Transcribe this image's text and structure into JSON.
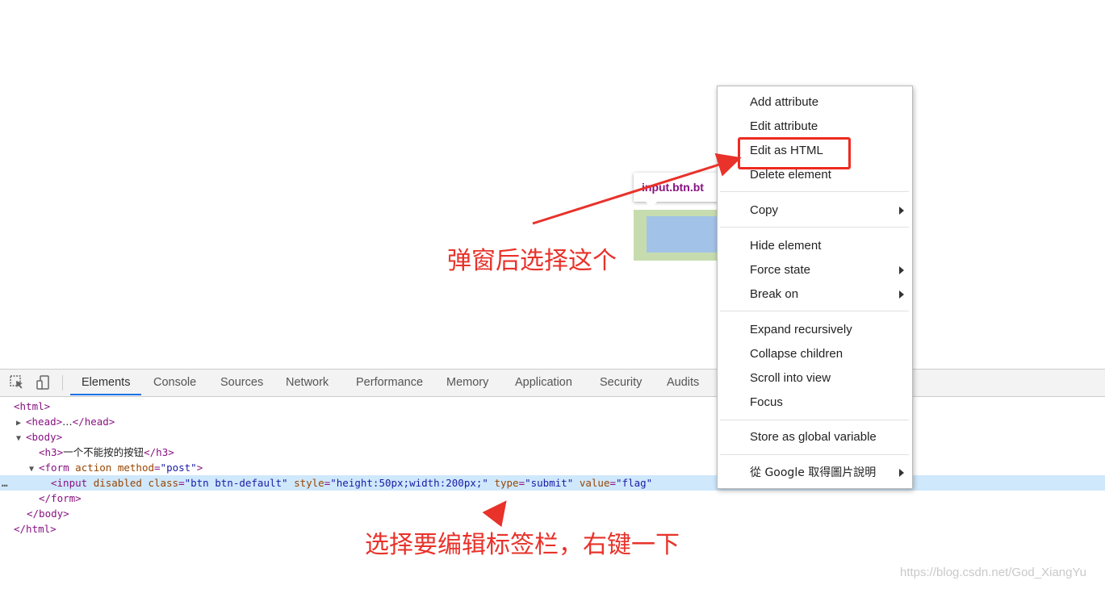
{
  "page": {
    "tooltip_label": "input.btn.bt"
  },
  "annotations": {
    "top": "弹窗后选择这个",
    "bottom": "选择要编辑标签栏，右键一下"
  },
  "devtools": {
    "tabs": [
      "Elements",
      "Console",
      "Sources",
      "Network",
      "Performance",
      "Memory",
      "Application",
      "Security",
      "Audits"
    ],
    "active_tab": "Elements",
    "dom": {
      "l1": "<html>",
      "l2_open": "<head>",
      "l2_ellipsis": "…",
      "l2_close": "</head>",
      "l3": "<body>",
      "l4_open": "<h3>",
      "l4_text": "一个不能按的按钮",
      "l4_close": "</h3>",
      "l5_tag": "<form",
      "l5_attr1": "action",
      "l5_attr2": "method",
      "l5_eq": "=",
      "l5_val2": "\"post\"",
      "l5_end": ">",
      "l6_tag": "<input",
      "l6_a1": "disabled",
      "l6_a2": "class",
      "l6_v2": "\"btn btn-default\"",
      "l6_a3": "style",
      "l6_v3": "\"height:50px;width:200px;\"",
      "l6_a4": "type",
      "l6_v4": "\"submit\"",
      "l6_a5": "value",
      "l6_v5": "\"flag\"",
      "eq": "=",
      "l7": "</form>",
      "l8": "</body>",
      "l9": "</html>",
      "dots": "…"
    }
  },
  "context_menu": {
    "items": [
      "Add attribute",
      "Edit attribute",
      "Edit as HTML",
      "Delete element",
      "Copy",
      "Hide element",
      "Force state",
      "Break on",
      "Expand recursively",
      "Collapse children",
      "Scroll into view",
      "Focus",
      "Store as global variable",
      "從 Google 取得圖片說明"
    ],
    "highlighted": "Edit as HTML"
  },
  "watermark": "https://blog.csdn.net/God_XiangYu",
  "colors": {
    "annotation": "#e8322a",
    "tag": "#881280",
    "attr": "#994500",
    "value": "#1a1aa6",
    "selection": "#cfe8fc",
    "active_tab_underline": "#1a73e8"
  }
}
